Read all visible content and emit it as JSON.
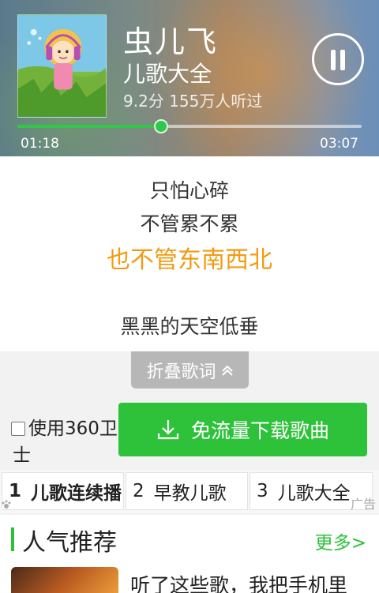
{
  "player": {
    "title": "虫儿飞",
    "album": "儿歌大全",
    "meta": "9.2分 155万人听过",
    "time_current": "01:18",
    "time_total": "03:07",
    "progress_fraction": 0.417,
    "accent_color": "#2fc84a"
  },
  "lyrics": {
    "lines": [
      "只怕心碎",
      "不管累不累",
      "也不管东南西北",
      "黑黑的天空低垂"
    ],
    "active_index": 2,
    "active_color": "#f39a13"
  },
  "fold_button": {
    "label": "折叠歌词",
    "icon": "chevron-up-icon"
  },
  "download": {
    "checkbox_label": "使用360卫",
    "checkbox_label_cont": "士",
    "checked": false,
    "button_label": "免流量下载歌曲",
    "button_icon": "download-icon",
    "button_color": "#2ec23b"
  },
  "ad": {
    "tabs": [
      {
        "num": "1",
        "label": "儿歌连续播"
      },
      {
        "num": "2",
        "label": "早教儿歌"
      },
      {
        "num": "3",
        "label": "儿歌大全"
      }
    ],
    "label": "广告"
  },
  "popular": {
    "title": "人气推荐",
    "more": "更多>",
    "items": [
      {
        "text": "听了这些歌，我把手机里"
      }
    ]
  }
}
